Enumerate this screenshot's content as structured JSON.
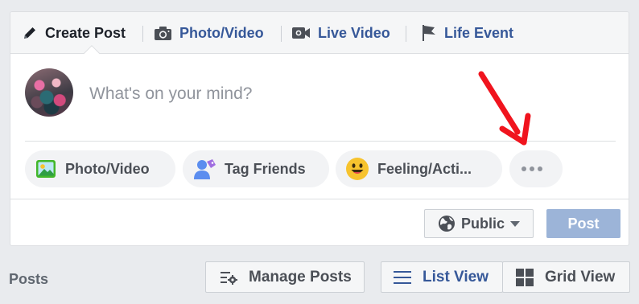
{
  "tabs": [
    {
      "label": "Create Post",
      "icon": "pencil-icon",
      "active": true
    },
    {
      "label": "Photo/Video",
      "icon": "camera-icon"
    },
    {
      "label": "Live Video",
      "icon": "video-camera-icon"
    },
    {
      "label": "Life Event",
      "icon": "flag-icon"
    }
  ],
  "composer": {
    "placeholder": "What's on your mind?",
    "value": ""
  },
  "actions": [
    {
      "label": "Photo/Video",
      "icon": "photo-icon"
    },
    {
      "label": "Tag Friends",
      "icon": "tag-friends-icon"
    },
    {
      "label": "Feeling/Acti...",
      "icon": "smiley-icon"
    },
    {
      "label": "",
      "icon": "more-dots-icon"
    }
  ],
  "footer": {
    "audience_label": "Public",
    "audience_icon": "globe-icon",
    "post_label": "Post"
  },
  "section": {
    "posts_label": "Posts",
    "manage_posts_label": "Manage Posts",
    "list_view_label": "List View",
    "grid_view_label": "Grid View"
  },
  "colors": {
    "link_blue": "#365899",
    "post_button_disabled": "#9cb4d8",
    "annotation_arrow": "#f0141e",
    "page_background": "#e9ebee"
  }
}
